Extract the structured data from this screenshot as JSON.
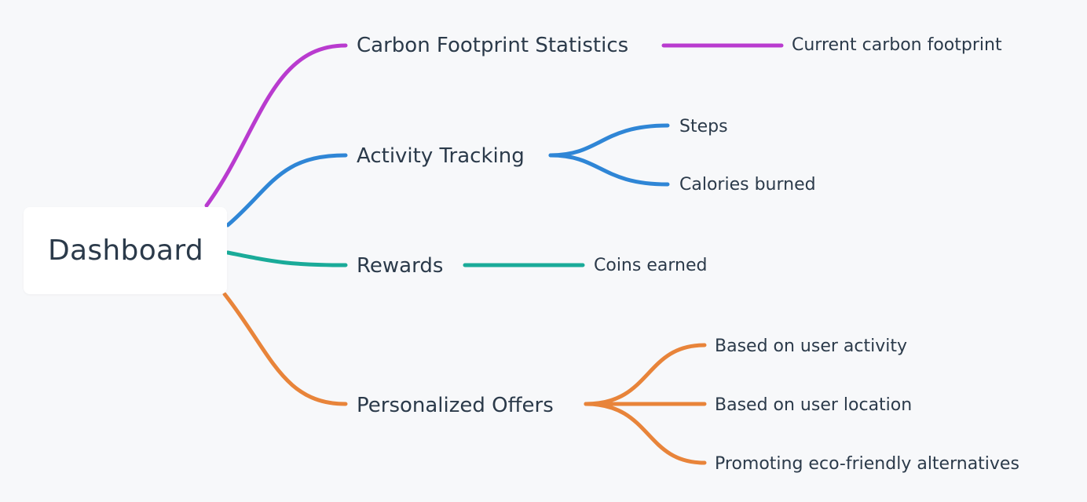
{
  "mindmap": {
    "root": {
      "label": "Dashboard"
    },
    "branches": [
      {
        "label": "Carbon Footprint Statistics",
        "color": "#b93bcf",
        "children": [
          {
            "label": "Current carbon footprint"
          }
        ]
      },
      {
        "label": "Activity Tracking",
        "color": "#2f86d6",
        "children": [
          {
            "label": "Steps"
          },
          {
            "label": "Calories burned"
          }
        ]
      },
      {
        "label": "Rewards",
        "color": "#1aab99",
        "children": [
          {
            "label": "Coins earned"
          }
        ]
      },
      {
        "label": "Personalized Offers",
        "color": "#e8843a",
        "children": [
          {
            "label": "Based on user activity"
          },
          {
            "label": "Based on user location"
          },
          {
            "label": "Promoting eco-friendly alternatives"
          }
        ]
      }
    ]
  }
}
